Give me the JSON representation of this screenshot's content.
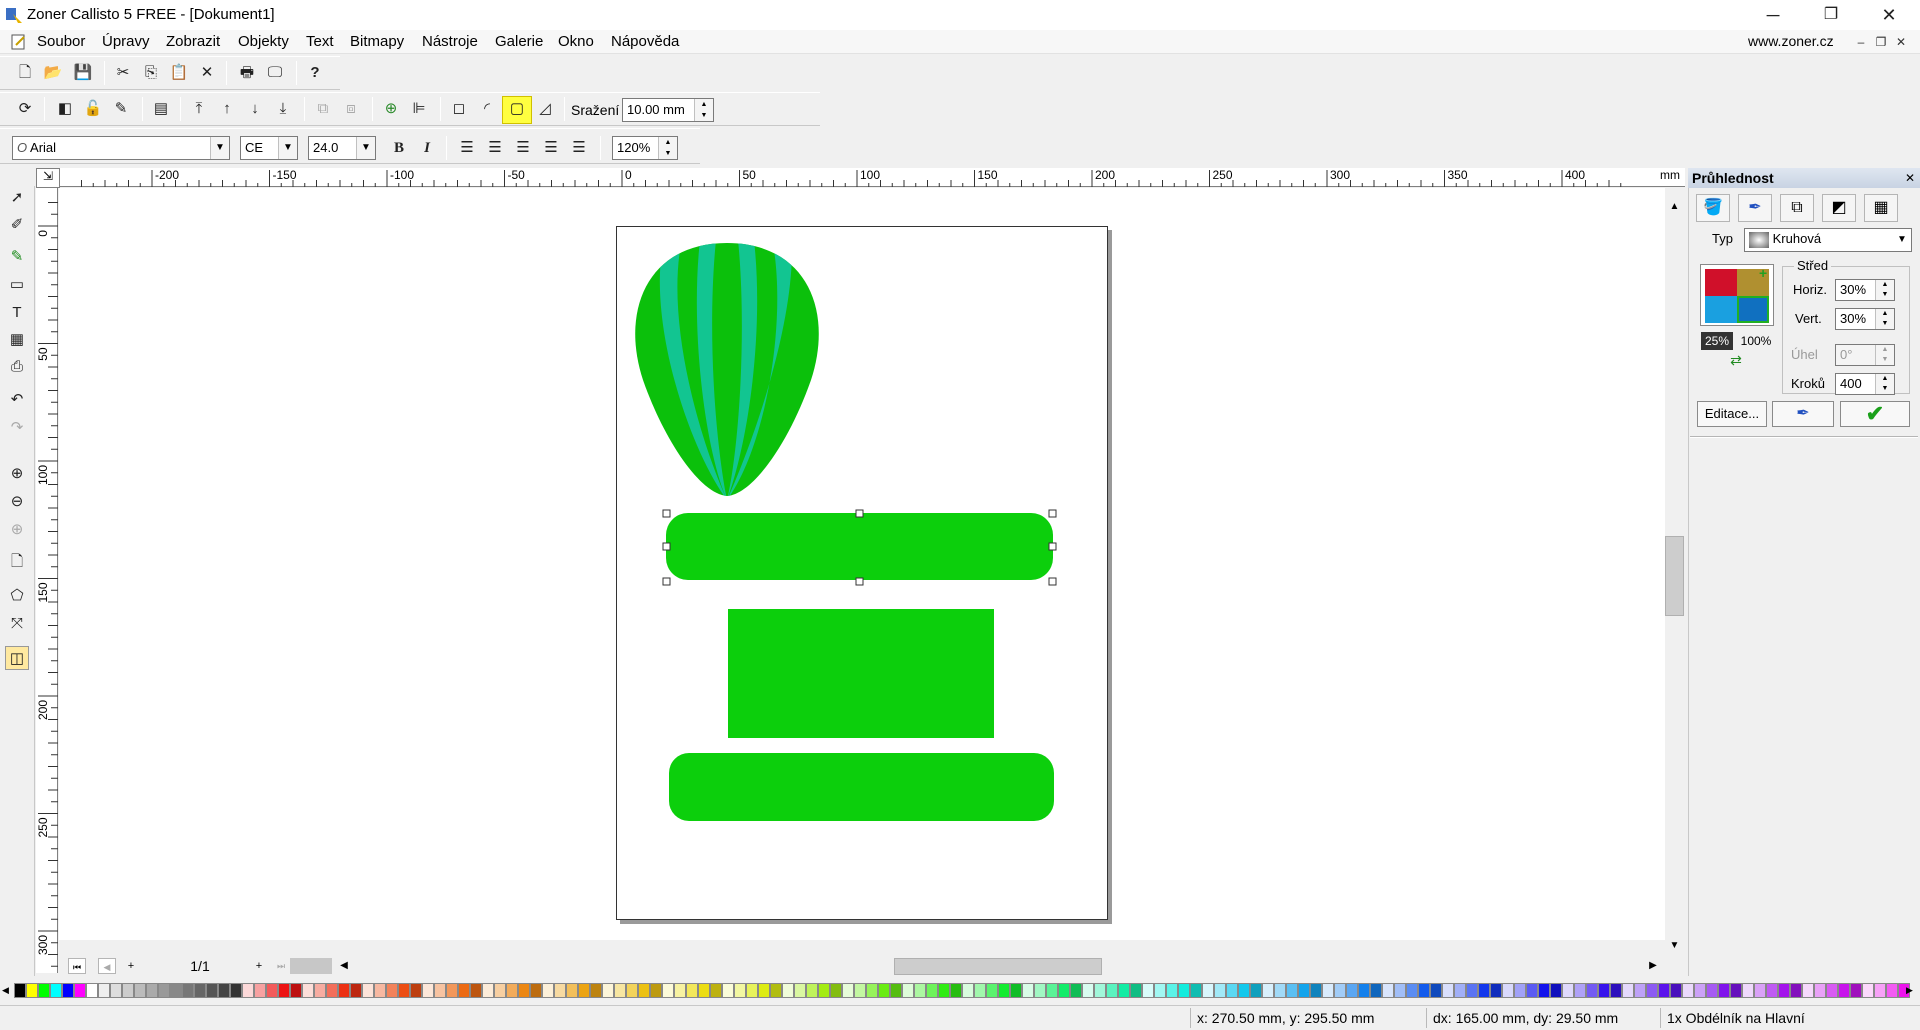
{
  "window": {
    "title": "Zoner Callisto 5 FREE - [Dokument1]",
    "minimize": "─",
    "maximize": "❐",
    "close": "✕"
  },
  "menu": {
    "items": [
      "Soubor",
      "Úpravy",
      "Zobrazit",
      "Objekty",
      "Text",
      "Bitmapy",
      "Nástroje",
      "Galerie",
      "Okno",
      "Nápověda"
    ],
    "url": "www.zoner.cz"
  },
  "toolbar2": {
    "corner_label": "Sražení",
    "corner_value": "10.00 mm"
  },
  "toolbar3": {
    "font": "Arial",
    "charset": "CE",
    "size": "24.0",
    "bold": "B",
    "italic": "I",
    "line_spacing": "120%"
  },
  "ruler": {
    "unit": "mm",
    "h_labels": [
      "-200",
      "-150",
      "-100",
      "-50",
      "0",
      "50",
      "100",
      "150",
      "200",
      "250",
      "300",
      "350",
      "400"
    ],
    "v_labels": [
      "0",
      "50",
      "100",
      "150",
      "200",
      "250",
      "300"
    ]
  },
  "pages": {
    "indicator": "1/1"
  },
  "panel": {
    "title": "Průhlednost",
    "type_label": "Typ",
    "type_value": "Kruhová",
    "center_group": "Střed",
    "horiz_label": "Horiz.",
    "horiz_value": "30%",
    "vert_label": "Vert.",
    "vert_value": "30%",
    "angle_label": "Úhel",
    "angle_value": "0°",
    "steps_label": "Kroků",
    "steps_value": "400",
    "opacity_start": "25%",
    "opacity_end": "100%",
    "edit_button": "Editace...",
    "apply_icon": "checkmark-icon",
    "picker_icon": "eyedropper-icon"
  },
  "status": {
    "coords": "x: 270.50 mm, y: 295.50 mm",
    "delta": "dx: 165.00 mm, dy: 29.50 mm",
    "selection": "1x Obdélník na Hlavní"
  },
  "colors": {
    "shape_green": "#0ccf0c",
    "balloon_stripe": "#12c591",
    "balloon_dark": "#0bc00b",
    "highlight": "#ffff40"
  }
}
